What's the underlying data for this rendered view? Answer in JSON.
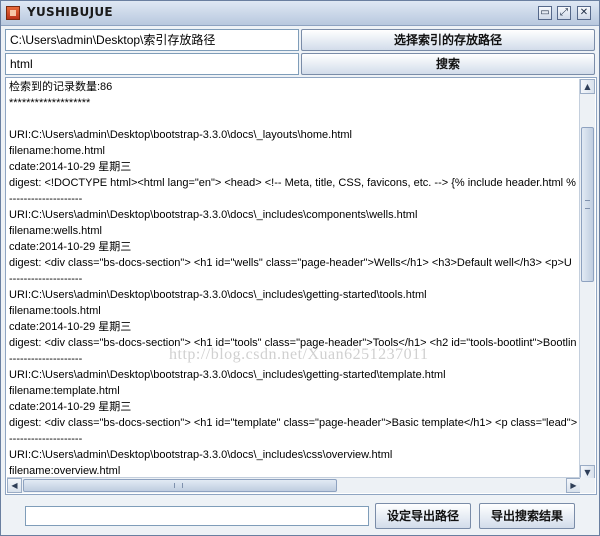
{
  "window": {
    "title": "YUSHIBUJUE",
    "controls": {
      "minimize": "▭",
      "maximize": "⤢",
      "close": "✕"
    }
  },
  "index_path": {
    "value": "C:\\Users\\admin\\Desktop\\索引存放路径",
    "button_label": "选择索引的存放路径"
  },
  "search": {
    "value": "html",
    "button_label": "搜索"
  },
  "results": {
    "lines": [
      "检索到的记录数量:86",
      "*******************",
      "",
      "URI:C:\\Users\\admin\\Desktop\\bootstrap-3.3.0\\docs\\_layouts\\home.html",
      "filename:home.html",
      "cdate:2014-10-29 星期三",
      "digest: <!DOCTYPE html><html lang=\"en\">  <head>    <!-- Meta, title, CSS, favicons, etc. -->    {% include header.html %",
      "--------------------",
      "URI:C:\\Users\\admin\\Desktop\\bootstrap-3.3.0\\docs\\_includes\\components\\wells.html",
      "filename:wells.html",
      "cdate:2014-10-29 星期三",
      "digest: <div class=\"bs-docs-section\">  <h1 id=\"wells\" class=\"page-header\">Wells</h1>  <h3>Default well</h3>  <p>U",
      "--------------------",
      "URI:C:\\Users\\admin\\Desktop\\bootstrap-3.3.0\\docs\\_includes\\getting-started\\tools.html",
      "filename:tools.html",
      "cdate:2014-10-29 星期三",
      "digest: <div class=\"bs-docs-section\">  <h1 id=\"tools\" class=\"page-header\">Tools</h1>  <h2 id=\"tools-bootlint\">Bootlin",
      "--------------------",
      "URI:C:\\Users\\admin\\Desktop\\bootstrap-3.3.0\\docs\\_includes\\getting-started\\template.html",
      "filename:template.html",
      "cdate:2014-10-29 星期三",
      "digest: <div class=\"bs-docs-section\">  <h1 id=\"template\" class=\"page-header\">Basic template</h1>  <p class=\"lead\">",
      "--------------------",
      "URI:C:\\Users\\admin\\Desktop\\bootstrap-3.3.0\\docs\\_includes\\css\\overview.html",
      "filename:overview.html",
      "cdate:2014-10-29 星期三"
    ],
    "watermark": "http://blog.csdn.net/Xuan6251237011"
  },
  "export": {
    "path_value": "",
    "set_path_label": "设定导出路径",
    "export_label": "导出搜索结果"
  }
}
